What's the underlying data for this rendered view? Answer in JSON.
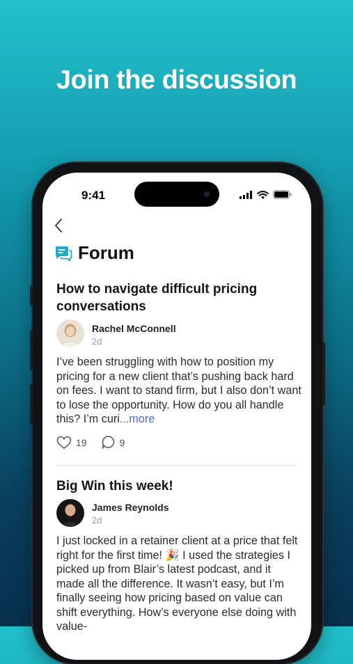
{
  "headline": "Join the discussion",
  "status_bar": {
    "time": "9:41"
  },
  "forum": {
    "title": "Forum"
  },
  "posts": [
    {
      "title": "How to navigate difficult pricing conversations",
      "author": "Rachel McConnell",
      "age": "2d",
      "body": "I’ve been struggling with how to position my pricing for a new client that’s pushing back hard on fees. I want to stand firm, but I also don’t want to lose the opportunity. How do you all handle this? I’m curi",
      "more": "...more",
      "likes": "19",
      "comments": "9"
    },
    {
      "title": "Big Win this week!",
      "author": "James Reynolds",
      "age": "2d",
      "body": "I just locked in a retainer client at a price that felt right for the first time! 🎉 I used the strategies I picked up from Blair’s latest podcast, and it made all the difference. It wasn’t easy, but I’m finally seeing how pricing based on value can shift everything. How’s everyone else doing with value-"
    }
  ],
  "colors": {
    "accent": "#22a9c4",
    "link": "#4e6bd8"
  },
  "icons": [
    "back-chevron-icon",
    "forum-chat-icon",
    "heart-icon",
    "comment-icon",
    "signal-icon",
    "wifi-icon",
    "battery-icon"
  ]
}
